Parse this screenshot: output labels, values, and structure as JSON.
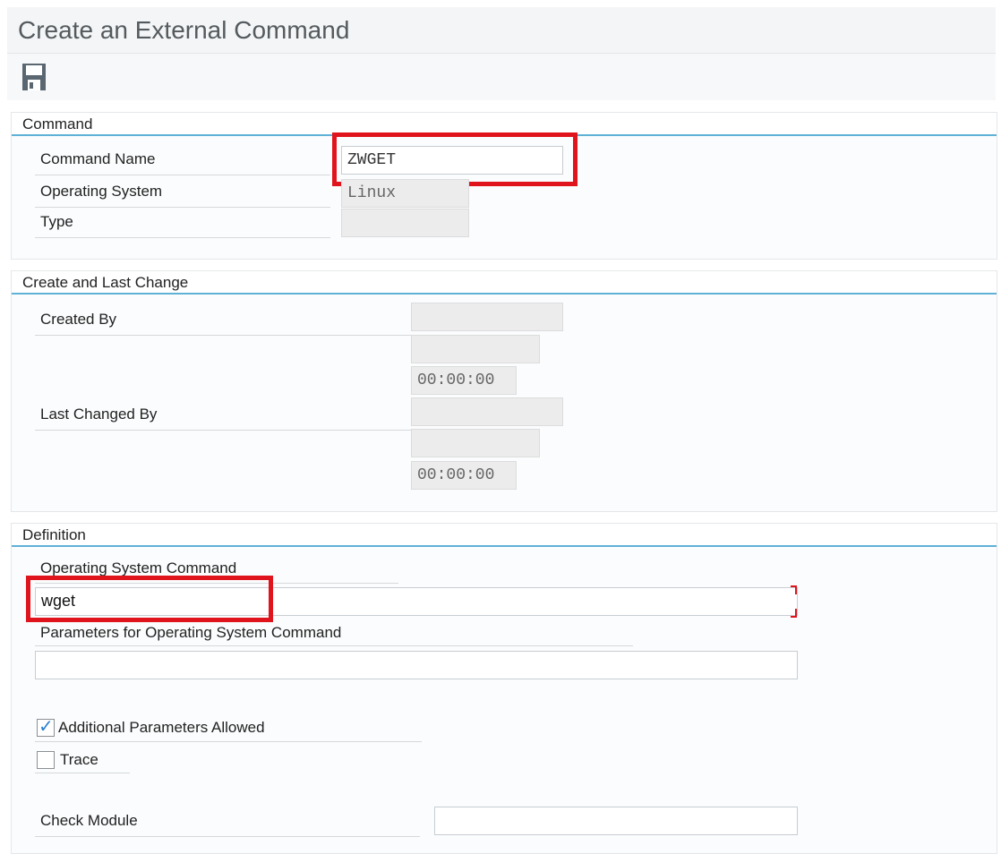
{
  "window": {
    "title": "Create an External Command"
  },
  "toolbar": {
    "save_icon": "save-icon"
  },
  "command": {
    "header": "Command",
    "command_name_label": "Command Name",
    "command_name_value": "ZWGET",
    "os_label": "Operating System",
    "os_value": "Linux",
    "type_label": "Type",
    "type_value": ""
  },
  "create_change": {
    "header": "Create and Last Change",
    "created_by_label": "Created By",
    "created_by_value": "",
    "created_date_value": "",
    "created_time_value": "00:00:00",
    "last_changed_label": "Last Changed By",
    "last_changed_value": "",
    "last_changed_date_value": "",
    "last_changed_time_value": "00:00:00"
  },
  "definition": {
    "header": "Definition",
    "os_command_label": "Operating System Command",
    "os_command_value": "wget",
    "params_label": "Parameters for Operating System Command",
    "params_value": "",
    "additional_params_label": "Additional Parameters Allowed",
    "additional_params_checked": true,
    "trace_label": "Trace",
    "trace_checked": false,
    "check_module_label": "Check Module",
    "check_module_value": ""
  },
  "colors": {
    "accent_line": "#5fb1d6",
    "highlight": "#e0141d",
    "check": "#2a7fd0"
  }
}
